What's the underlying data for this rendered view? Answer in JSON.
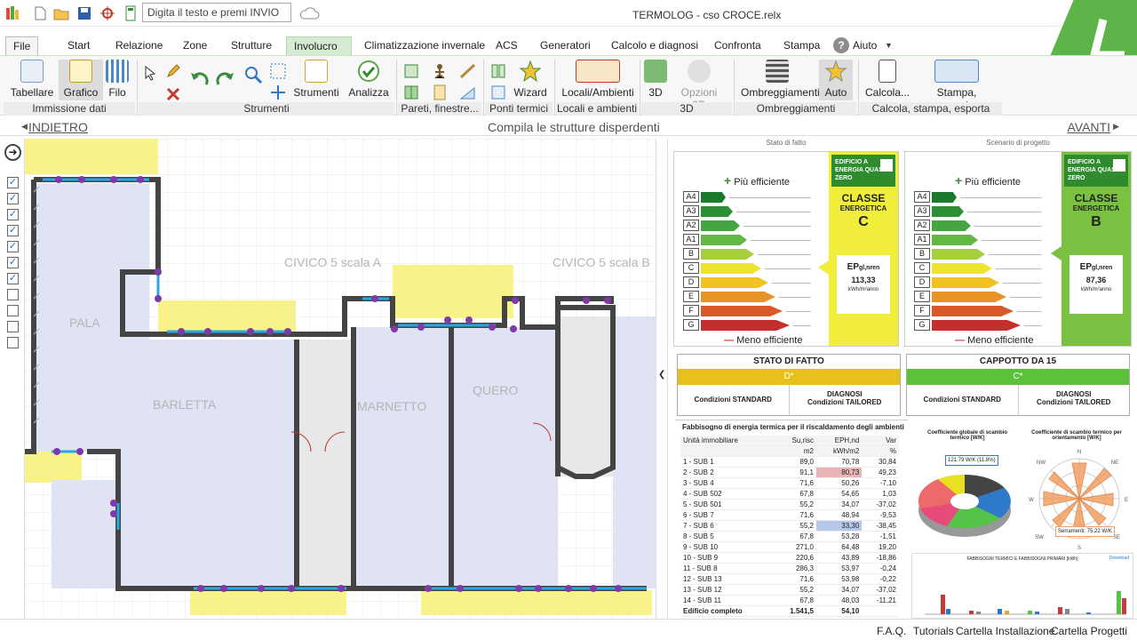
{
  "app": {
    "title": "TERMOLOG - cso CROCE.relx",
    "search_placeholder": "Digita il testo e premi INVIO"
  },
  "menu": {
    "file": "File",
    "tabs": [
      "Start",
      "Relazione",
      "Zone",
      "Strutture",
      "Involucro",
      "Climatizzazione invernale",
      "ACS",
      "Generatori",
      "Calcolo e diagnosi",
      "Confronta",
      "Stampa",
      "Aiuto"
    ]
  },
  "ribbon": {
    "buttons": {
      "tabellare": "Tabellare",
      "grafico": "Grafico",
      "filo": "Filo",
      "strumenti": "Strumenti",
      "analizza": "Analizza",
      "wizard": "Wizard",
      "locali": "Locali/Ambienti",
      "b3d": "3D",
      "opzioni3d": "Opzioni 3D",
      "ombreggiamenti": "Ombreggiamenti",
      "auto": "Auto",
      "calcola": "Calcola...",
      "stampa": "Stampa, esporta"
    },
    "groups": {
      "immissione": "Immissione dati",
      "strumenti": "Strumenti",
      "pareti": "Pareti, finestre...",
      "ponti": "Ponti termici",
      "locali": "Locali e ambienti",
      "g3d": "3D",
      "ombr": "Ombreggiamenti",
      "calc": "Calcola, stampa, esporta"
    }
  },
  "nav": {
    "back": "INDIETRO",
    "center": "Compila le strutture disperdenti",
    "forward": "AVANTI"
  },
  "plan": {
    "labels": [
      "CIVICO 5 scala A",
      "CIVICO 5 scala B",
      "PALA",
      "BARLETTA",
      "MARNETTO",
      "QUERO"
    ]
  },
  "energy": {
    "left": {
      "header": "Stato di fatto",
      "more": "Più efficiente",
      "less": "Meno efficiente",
      "nzeb": "EDIFICIO A ENERGIA QUASI ZERO",
      "classe": "CLASSE",
      "energetica": "ENERGETICA",
      "class_letter": "C",
      "ep_label": "EP",
      "ep_sub": "gl,nren",
      "ep_value": "113,33",
      "ep_unit": "kWh/m²anno"
    },
    "right": {
      "header": "Scenario di progetto",
      "more": "Più efficiente",
      "less": "Meno efficiente",
      "nzeb": "EDIFICIO A ENERGIA QUASI ZERO",
      "classe": "CLASSE",
      "energetica": "ENERGETICA",
      "class_letter": "B",
      "ep_label": "EP",
      "ep_sub": "gl,nren",
      "ep_value": "87,36",
      "ep_unit": "kWh/m²anno"
    },
    "classes": [
      "A4",
      "A3",
      "A2",
      "A1",
      "B",
      "C",
      "D",
      "E",
      "F",
      "G"
    ]
  },
  "scenarios": {
    "a": {
      "title": "STATO DI FATTO",
      "badge": "D*",
      "std": "Condizioni STANDARD",
      "diag1": "DIAGNOSI",
      "diag2": "Condizioni TAILORED"
    },
    "b": {
      "title": "CAPPOTTO DA 15",
      "badge": "C*",
      "std": "Condizioni STANDARD",
      "diag1": "DIAGNOSI",
      "diag2": "Condizioni TAILORED"
    }
  },
  "table": {
    "title": "Fabbisogno di energia termica per il riscaldamento degli ambienti",
    "headers": [
      "Unità immobiliare",
      "Su,risc",
      "EPH,nd",
      "Var"
    ],
    "units": [
      "",
      "m2",
      "kWh/m2",
      "%"
    ],
    "rows": [
      [
        "1 - SUB 1",
        "89,0",
        "70,78",
        "30,84"
      ],
      [
        "2 - SUB 2",
        "91,1",
        "80,73",
        "49,23"
      ],
      [
        "3 - SUB 4",
        "71,6",
        "50,26",
        "-7,10"
      ],
      [
        "4 - SUB 502",
        "67,8",
        "54,65",
        "1,03"
      ],
      [
        "5 - SUB 501",
        "55,2",
        "34,07",
        "-37,02"
      ],
      [
        "6 - SUB 7",
        "71,6",
        "48,94",
        "-9,53"
      ],
      [
        "7 - SUB 6",
        "55,2",
        "33,30",
        "-38,45"
      ],
      [
        "8 - SUB 5",
        "67,8",
        "53,28",
        "-1,51"
      ],
      [
        "9 - SUB 10",
        "271,0",
        "64,48",
        "19,20"
      ],
      [
        "10 - SUB 9",
        "220,6",
        "43,89",
        "-18,86"
      ],
      [
        "11 - SUB 8",
        "286,3",
        "53,97",
        "-0,24"
      ],
      [
        "12 - SUB 13",
        "71,6",
        "53,98",
        "-0,22"
      ],
      [
        "13 - SUB 12",
        "55,2",
        "34,07",
        "-37,02"
      ],
      [
        "14 - SUB 11",
        "67,8",
        "48,03",
        "-11,21"
      ]
    ],
    "total": [
      "Edificio completo",
      "1.541,5",
      "54,10",
      ""
    ]
  },
  "charts": {
    "pie_title": "Coefficiente globale di scambio termico [W/K]",
    "pie_tooltip": "121.79 W/K (11.8%)",
    "radar_title": "Coefficiente di scambio termico per orientamento [W/K]",
    "radar_tooltip": "Serramenti: 75.22 W/K",
    "radar_dirs": [
      "N",
      "NE",
      "E",
      "SE",
      "S",
      "SW",
      "W",
      "NW"
    ],
    "bar_title": "FABBISOGNI TERMICI E FABBISOGNI PRIMARI [kWh]",
    "bar_link": "Download"
  },
  "status": [
    "F.A.Q.",
    "Tutorials",
    "Cartella Installazione",
    "Cartella Progetti"
  ]
}
